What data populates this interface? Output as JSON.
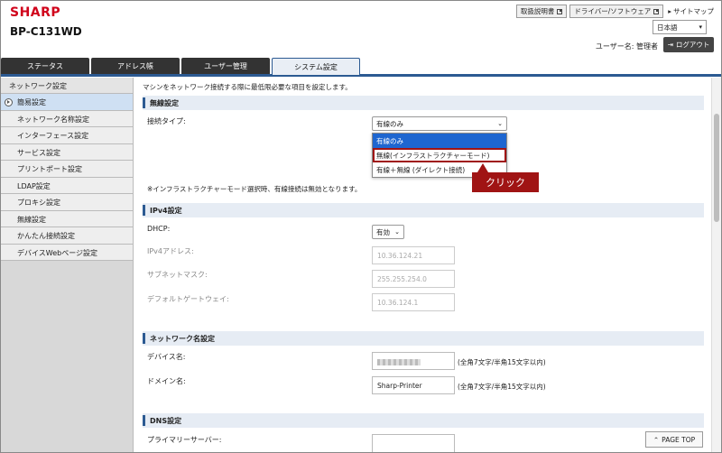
{
  "header": {
    "brand": "SHARP",
    "model": "BP-C131WD",
    "links": [
      "取扱説明書",
      "ドライバー/ソフトウェア"
    ],
    "sitemap": "サイトマップ",
    "language": "日本語",
    "user_label": "ユーザー名: 管理者",
    "logout": "ログアウト"
  },
  "tabs": [
    "ステータス",
    "アドレス帳",
    "ユーザー管理",
    "システム設定"
  ],
  "sidebar": {
    "heading": "ネットワーク設定",
    "items": [
      "簡易設定",
      "ネットワーク名称設定",
      "インターフェース設定",
      "サービス設定",
      "プリントポート設定",
      "LDAP設定",
      "プロキシ設定",
      "無線設定",
      "かんたん接続設定",
      "デバイスWebページ設定"
    ]
  },
  "main": {
    "intro": "マシンをネットワーク接続する際に最低限必要な項目を設定します。",
    "wireless": {
      "title": "無線設定",
      "conn_label": "接続タイプ:",
      "conn_value": "有線のみ",
      "options": [
        "有線のみ",
        "無線(インフラストラクチャーモード)",
        "有線＋無線 (ダイレクト接続)"
      ],
      "note": "※インフラストラクチャーモード選択時、有線接続は無効となります。"
    },
    "ipv4": {
      "title": "IPv4設定",
      "dhcp_label": "DHCP:",
      "dhcp_value": "有効",
      "ip_label": "IPv4アドレス:",
      "ip_value": "10.36.124.21",
      "mask_label": "サブネットマスク:",
      "mask_value": "255.255.254.0",
      "gw_label": "デフォルトゲートウェイ:",
      "gw_value": "10.36.124.1"
    },
    "netname": {
      "title": "ネットワーク名設定",
      "device_label": "デバイス名:",
      "device_hint": "(全角7文字/半角15文字以内)",
      "domain_label": "ドメイン名:",
      "domain_value": "Sharp-Printer",
      "domain_hint": "(全角7文字/半角15文字以内)"
    },
    "dns": {
      "title": "DNS設定",
      "primary_label": "プライマリーサーバー:"
    }
  },
  "callout": "クリック",
  "page_top": "PAGE TOP"
}
